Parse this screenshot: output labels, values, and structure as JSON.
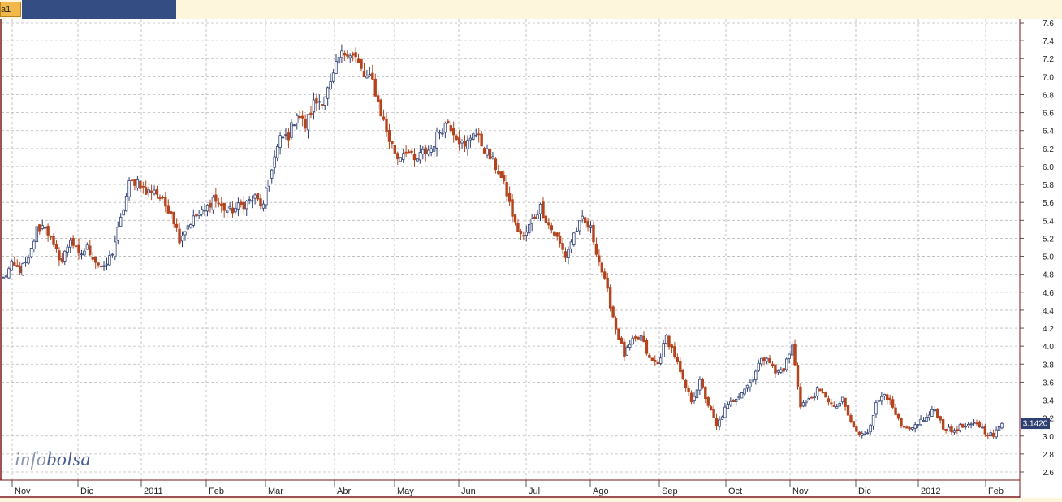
{
  "tab": {
    "label": "a1"
  },
  "watermark": {
    "part1": "info",
    "part2": "bolsa"
  },
  "colors": {
    "up": "#2e3f72",
    "down": "#b5441e",
    "price_label_bg": "#2e3f72",
    "grid": "#b8b8b8",
    "axis_frame": "#7a1a1a"
  },
  "chart_data": {
    "type": "candlestick",
    "title": "",
    "xlabel": "",
    "ylabel": "",
    "ylim": [
      2.5,
      7.6
    ],
    "y_ticks": [
      "2.6",
      "2.8",
      "3.0",
      "3.2",
      "3.4",
      "3.6",
      "3.8",
      "4.0",
      "4.2",
      "4.4",
      "4.6",
      "4.8",
      "5.0",
      "5.2",
      "5.4",
      "5.6",
      "5.8",
      "6.0",
      "6.2",
      "6.4",
      "6.6",
      "6.8",
      "7.0",
      "7.2",
      "7.4",
      "7.6"
    ],
    "x_tick_labels": [
      "Nov",
      "Dic",
      "2011",
      "Feb",
      "Mar",
      "Abr",
      "May",
      "Jun",
      "Jul",
      "Ago",
      "Sep",
      "Oct",
      "Nov",
      "Dic",
      "2012",
      "Feb"
    ],
    "grid": true,
    "last_price": "3.1420",
    "closes": [
      4.75,
      4.9,
      4.85,
      4.95,
      5.3,
      5.35,
      5.1,
      4.95,
      5.2,
      5.0,
      5.1,
      4.95,
      4.85,
      5.05,
      5.4,
      5.8,
      5.85,
      5.7,
      5.75,
      5.6,
      5.5,
      5.2,
      5.35,
      5.45,
      5.5,
      5.65,
      5.55,
      5.5,
      5.55,
      5.6,
      5.65,
      5.55,
      6.0,
      6.3,
      6.35,
      6.6,
      6.45,
      6.7,
      6.75,
      6.9,
      7.2,
      7.3,
      7.2,
      7.0,
      6.95,
      6.6,
      6.3,
      6.1,
      6.2,
      6.05,
      6.15,
      6.2,
      6.4,
      6.5,
      6.35,
      6.2,
      6.4,
      6.25,
      6.1,
      5.95,
      5.7,
      5.35,
      5.2,
      5.4,
      5.55,
      5.35,
      5.2,
      5.0,
      5.25,
      5.4,
      5.3,
      4.95,
      4.6,
      4.2,
      3.9,
      4.05,
      4.1,
      3.85,
      3.8,
      4.1,
      3.9,
      3.6,
      3.4,
      3.6,
      3.35,
      3.1,
      3.3,
      3.4,
      3.5,
      3.6,
      3.8,
      3.9,
      3.7,
      3.75,
      4.0,
      3.35,
      3.4,
      3.5,
      3.45,
      3.3,
      3.4,
      3.15,
      3.0,
      3.05,
      3.35,
      3.5,
      3.3,
      3.1,
      3.05,
      3.15,
      3.2,
      3.3,
      3.1,
      3.05,
      3.1,
      3.1,
      3.15,
      3.05,
      3.0,
      3.14
    ]
  }
}
